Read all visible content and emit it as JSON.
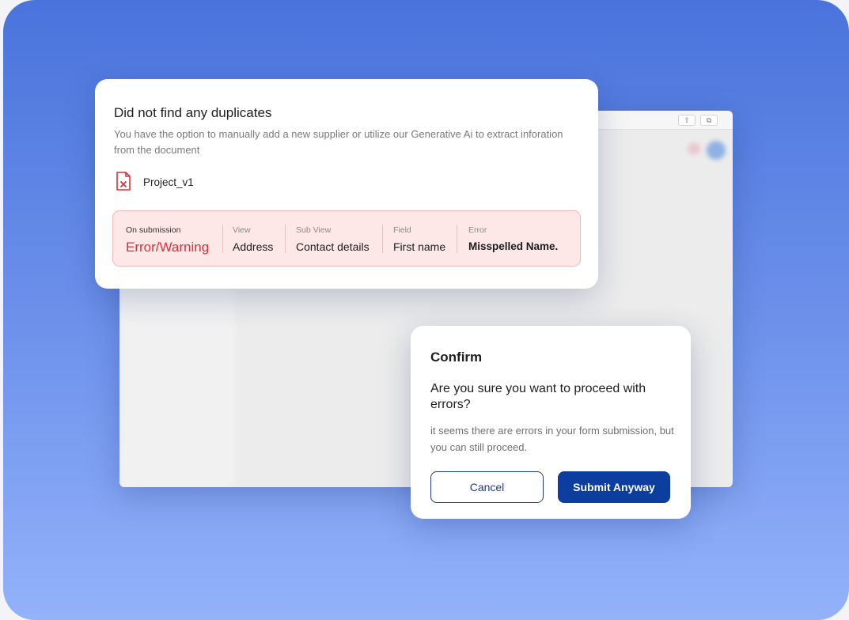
{
  "colors": {
    "background_top": "#4a74dc",
    "background_bottom": "#93b2fa",
    "error_text": "#d4333a",
    "error_box_bg": "#fde7e7",
    "primary_button": "#0c3ea0"
  },
  "background_window": {
    "toolbar_icons": [
      "share-icon",
      "duplicate-icon"
    ]
  },
  "duplicates_card": {
    "title": "Did not find any duplicates",
    "description": "You have the option to manually add a new supplier or utilize our Generative Ai to extract inforation from the document",
    "file": {
      "icon": "file-error-icon",
      "name": "Project_v1"
    },
    "error_row": {
      "on_submission": {
        "label": "On submission",
        "value": "Error/Warning"
      },
      "view": {
        "label": "View",
        "value": "Address"
      },
      "sub_view": {
        "label": "Sub View",
        "value": "Contact details"
      },
      "field": {
        "label": "Field",
        "value": "First name"
      },
      "error": {
        "label": "Error",
        "value": "Misspelled Name."
      }
    }
  },
  "confirm_dialog": {
    "title": "Confirm",
    "question": "Are you sure you want to proceed with errors?",
    "description": "it seems there are errors in your form submission, but you can still proceed.",
    "cancel_label": "Cancel",
    "submit_label": "Submit Anyway"
  }
}
